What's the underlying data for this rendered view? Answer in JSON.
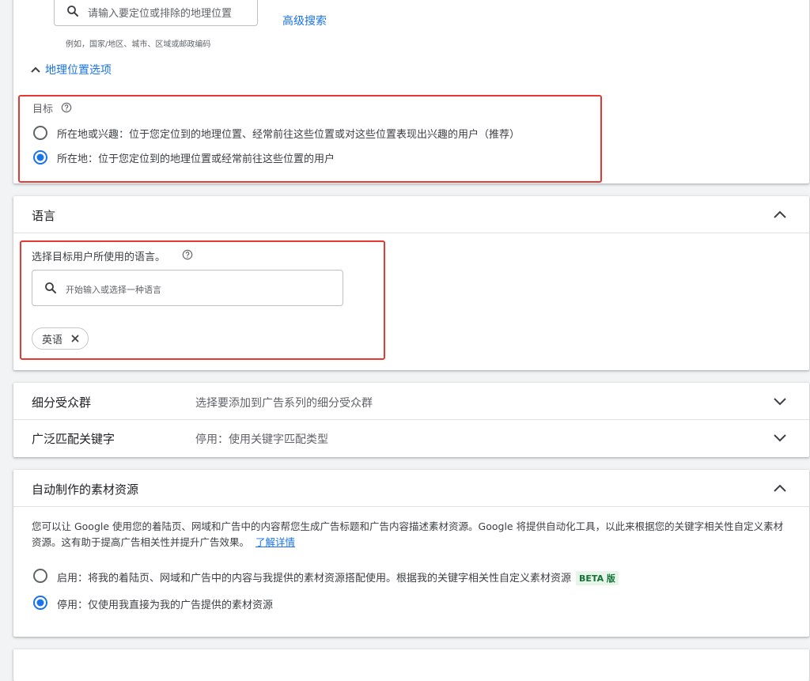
{
  "location": {
    "search_placeholder": "请输入要定位或排除的地理位置",
    "hint": "例如，国家/地区、城市、区域或邮政编码",
    "advanced_search": "高级搜索",
    "options_toggle": "地理位置选项",
    "target_label": "目标",
    "radio_options": [
      {
        "label": "所在地或兴趣：位于您定位到的地理位置、经常前往这些位置或对这些位置表现出兴趣的用户（推荐）",
        "selected": false
      },
      {
        "label": "所在地：位于您定位到的地理位置或经常前往这些位置的用户",
        "selected": true
      }
    ]
  },
  "language": {
    "title": "语言",
    "prompt": "选择目标用户所使用的语言。",
    "search_placeholder": "开始输入或选择一种语言",
    "chips": [
      "英语"
    ]
  },
  "audience": {
    "title": "细分受众群",
    "summary": "选择要添加到广告系列的细分受众群"
  },
  "broad_match": {
    "title": "广泛匹配关键字",
    "summary": "停用：使用关键字匹配类型"
  },
  "auto_assets": {
    "title": "自动制作的素材资源",
    "description": "您可以让 Google 使用您的着陆页、网域和广告中的内容帮您生成广告标题和广告内容描述素材资源。Google 将提供自动化工具，以此来根据您的关键字相关性自定义素材资源。这有助于提高广告相关性并提升广告效果。",
    "learn_more": "了解详情",
    "radio_options": [
      {
        "label": "启用：将我的着陆页、网域和广告中的内容与我提供的素材资源搭配使用。根据我的关键字相关性自定义素材资源",
        "badge": "BETA 版",
        "selected": false
      },
      {
        "label": "停用：仅使用我直接为我的广告提供的素材资源",
        "selected": true
      }
    ]
  },
  "colors": {
    "accent": "#1a73e8",
    "highlight_box": "#e53935",
    "beta_bg": "#e6f4ea",
    "beta_text": "#137333"
  }
}
